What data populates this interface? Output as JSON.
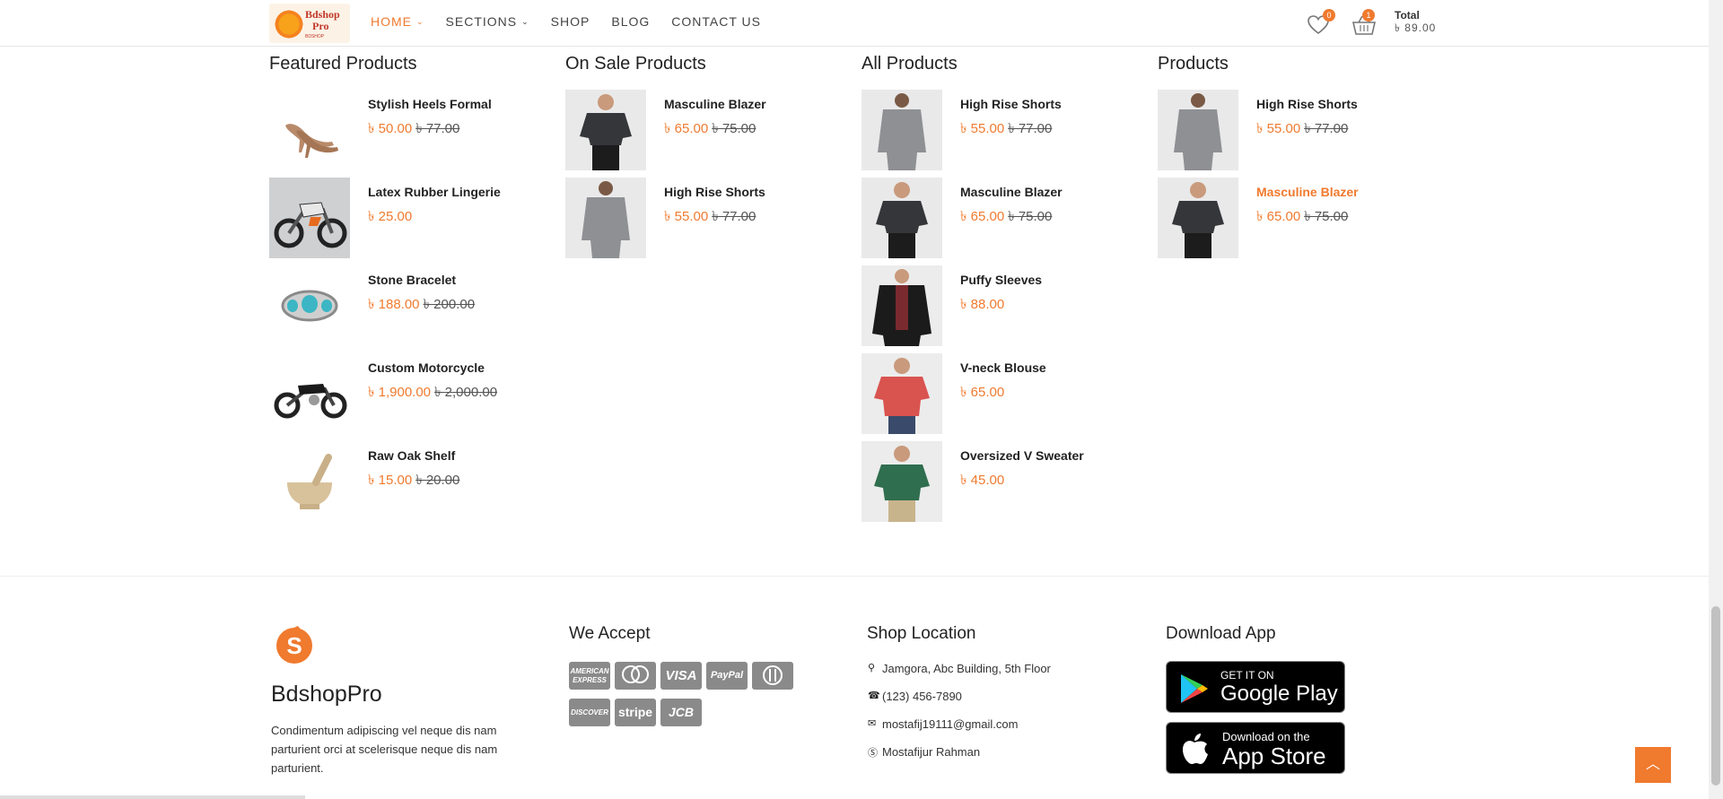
{
  "header": {
    "logo_text_1": "Bdshop",
    "logo_text_2": "Pro",
    "logo_sub": "BDSHOP",
    "nav": [
      {
        "label": "HOME",
        "active": true,
        "dropdown": true
      },
      {
        "label": "SECTIONS",
        "active": false,
        "dropdown": true
      },
      {
        "label": "SHOP",
        "active": false,
        "dropdown": false
      },
      {
        "label": "BLOG",
        "active": false,
        "dropdown": false
      },
      {
        "label": "CONTACT US",
        "active": false,
        "dropdown": false
      }
    ],
    "wishlist_count": "0",
    "cart_count": "1",
    "total_label": "Total",
    "total_value": "৳ 89.00"
  },
  "columns": [
    {
      "title": "Featured Products",
      "items": [
        {
          "name": "Stylish Heels Formal",
          "price": "৳ 50.00",
          "old": "৳ 77.00",
          "image": "heels"
        },
        {
          "name": "Latex Rubber Lingerie",
          "price": "৳ 25.00",
          "old": "",
          "image": "motorbike"
        },
        {
          "name": "Stone Bracelet",
          "price": "৳ 188.00",
          "old": "৳ 200.00",
          "image": "bracelet"
        },
        {
          "name": "Custom Motorcycle",
          "price": "৳ 1,900.00",
          "old": "৳ 2,000.00",
          "image": "motorcycle"
        },
        {
          "name": "Raw Oak Shelf",
          "price": "৳ 15.00",
          "old": "৳ 20.00",
          "image": "mortar"
        }
      ]
    },
    {
      "title": "On Sale Products",
      "items": [
        {
          "name": "Masculine Blazer",
          "price": "৳ 65.00",
          "old": "৳ 75.00",
          "image": "dark-tee"
        },
        {
          "name": "High Rise Shorts",
          "price": "৳ 55.00",
          "old": "৳ 77.00",
          "image": "grey-sweater"
        }
      ]
    },
    {
      "title": "All Products",
      "items": [
        {
          "name": "High Rise Shorts",
          "price": "৳ 55.00",
          "old": "৳ 77.00",
          "image": "grey-sweater"
        },
        {
          "name": "Masculine Blazer",
          "price": "৳ 65.00",
          "old": "৳ 75.00",
          "image": "dark-tee"
        },
        {
          "name": "Puffy Sleeves",
          "price": "৳ 88.00",
          "old": "",
          "image": "black-jacket"
        },
        {
          "name": "V-neck Blouse",
          "price": "৳ 65.00",
          "old": "",
          "image": "red-tee"
        },
        {
          "name": "Oversized V Sweater",
          "price": "৳ 45.00",
          "old": "",
          "image": "green-tee"
        }
      ]
    },
    {
      "title": "Products",
      "items": [
        {
          "name": "High Rise Shorts",
          "price": "৳ 55.00",
          "old": "৳ 77.00",
          "image": "grey-sweater",
          "highlight": false
        },
        {
          "name": "Masculine Blazer",
          "price": "৳ 65.00",
          "old": "৳ 75.00",
          "image": "dark-tee",
          "highlight": true
        }
      ]
    }
  ],
  "footer": {
    "brand": "BdshopPro",
    "description": "Condimentum adipiscing vel neque dis nam parturient orci at scelerisque neque dis nam parturient.",
    "accept_title": "We Accept",
    "cards": [
      "AMEX",
      "MC",
      "VISA",
      "PayPal",
      "Diners",
      "DISCOVER",
      "stripe",
      "JCB"
    ],
    "location_title": "Shop Location",
    "location": [
      {
        "icon": "map-marker-icon",
        "text": "Jamgora, Abc Building, 5th Floor"
      },
      {
        "icon": "phone-icon",
        "text": "(123) 456-7890"
      },
      {
        "icon": "envelope-icon",
        "text": "mostafij19111@gmail.com"
      },
      {
        "icon": "skype-icon",
        "text": "Mostafijur Rahman"
      }
    ],
    "app_title": "Download App",
    "google_small": "GET IT ON",
    "google_big": "Google Play",
    "apple_small": "Download on the",
    "apple_big": "App Store"
  },
  "colors": {
    "accent": "#f07a2e"
  }
}
